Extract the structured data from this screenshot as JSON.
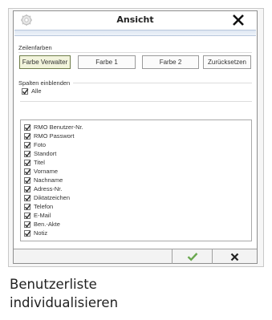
{
  "dialog": {
    "title": "Ansicht",
    "title_icon": "gear-icon",
    "close_icon": "close-icon"
  },
  "row_colors": {
    "label": "Zeilenfarben",
    "buttons": [
      "Farbe Verwalter",
      "Farbe 1",
      "Farbe 2",
      "Zurücksetzen"
    ],
    "selected_button": "Farbe Verwalter"
  },
  "columns": {
    "label": "Spalten einblenden",
    "all_label": "Alle",
    "all_checked": true,
    "items": [
      {
        "label": "RMO Benutzer-Nr.",
        "checked": true
      },
      {
        "label": "RMO Passwort",
        "checked": true
      },
      {
        "label": "Foto",
        "checked": true
      },
      {
        "label": "Standort",
        "checked": true
      },
      {
        "label": "Titel",
        "checked": true
      },
      {
        "label": "Vorname",
        "checked": true
      },
      {
        "label": "Nachname",
        "checked": true
      },
      {
        "label": "Adress-Nr.",
        "checked": true
      },
      {
        "label": "Diktatzeichen",
        "checked": true
      },
      {
        "label": "Telefon",
        "checked": true
      },
      {
        "label": "E-Mail",
        "checked": true
      },
      {
        "label": "Ben.-Akte",
        "checked": true
      },
      {
        "label": "Notiz",
        "checked": true
      }
    ]
  },
  "footer": {
    "confirm_icon": "checkmark-icon",
    "cancel_icon": "close-icon"
  },
  "caption": {
    "line1": "Benutzerliste",
    "line2": "individualisieren"
  },
  "colors": {
    "check": "#2a2a2a",
    "confirm_green": "#6aa84f",
    "selected_button_bg": "#f2f4dc"
  }
}
